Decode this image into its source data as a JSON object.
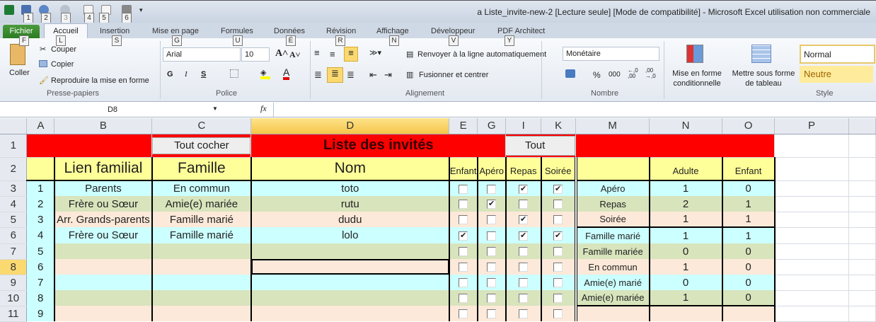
{
  "window": {
    "title": "a Liste_invite-new-2  [Lecture seule]  [Mode de compatibilité]  -  Microsoft Excel utilisation non commerciale"
  },
  "qat_keys": [
    "1",
    "2",
    "3",
    "4",
    "5",
    "6"
  ],
  "tabs": [
    {
      "label": "Fichier",
      "key": "F"
    },
    {
      "label": "Accueil",
      "key": "L"
    },
    {
      "label": "Insertion",
      "key": "S"
    },
    {
      "label": "Mise en page",
      "key": "G"
    },
    {
      "label": "Formules",
      "key": "U"
    },
    {
      "label": "Données",
      "key": "É"
    },
    {
      "label": "Révision",
      "key": "R"
    },
    {
      "label": "Affichage",
      "key": "N"
    },
    {
      "label": "Développeur",
      "key": "V"
    },
    {
      "label": "PDF Architect",
      "key": "Y"
    }
  ],
  "ribbon": {
    "clipboard": {
      "paste": "Coller",
      "cut": "Couper",
      "copy": "Copier",
      "format_painter": "Reproduire la mise en forme",
      "label": "Presse-papiers"
    },
    "font": {
      "name": "Arial",
      "size": "10",
      "bold": "G",
      "italic": "I",
      "underline": "S",
      "label": "Police"
    },
    "alignment": {
      "wrap": "Renvoyer à la ligne automatiquement",
      "merge": "Fusionner et centrer",
      "label": "Alignement"
    },
    "number": {
      "format": "Monétaire",
      "percent": "%",
      "thousands": "000",
      "label": "Nombre"
    },
    "styles": {
      "conditional": "Mise en forme conditionnelle",
      "table": "Mettre sous forme de tableau",
      "normal": "Normal",
      "neutral": "Neutre",
      "label": "Style"
    }
  },
  "formula_bar": {
    "name_box": "D8",
    "fx": "fx",
    "value": ""
  },
  "columns": [
    "A",
    "B",
    "C",
    "D",
    "E",
    "G",
    "I",
    "K",
    "M",
    "N",
    "O",
    "P"
  ],
  "row1": {
    "button_check_all": "Tout  cocher",
    "title": "Liste des invités",
    "button_all": "Tout"
  },
  "headers": {
    "lien": "Lien familial",
    "famille": "Famille",
    "nom": "Nom",
    "enfant": "Enfant",
    "apero": "Apéro",
    "repas": "Repas",
    "soiree": "Soirée",
    "adulte": "Adulte",
    "enfant2": "Enfant"
  },
  "guests": [
    {
      "row": "3",
      "num": "1",
      "lien": "Parents",
      "famille": "En commun",
      "nom": "toto",
      "enfant": false,
      "apero": false,
      "repas": true,
      "soiree": true
    },
    {
      "row": "4",
      "num": "2",
      "lien": "Frère ou Sœur",
      "famille": "Amie(e) mariée",
      "nom": "rutu",
      "enfant": false,
      "apero": true,
      "repas": false,
      "soiree": false
    },
    {
      "row": "5",
      "num": "3",
      "lien": "Arr. Grands-parents",
      "famille": "Famille marié",
      "nom": "dudu",
      "enfant": false,
      "apero": false,
      "repas": true,
      "soiree": false
    },
    {
      "row": "6",
      "num": "4",
      "lien": "Frère ou Sœur",
      "famille": "Famille marié",
      "nom": "lolo",
      "enfant": true,
      "apero": false,
      "repas": true,
      "soiree": true
    },
    {
      "row": "7",
      "num": "5",
      "lien": "",
      "famille": "",
      "nom": "",
      "enfant": false,
      "apero": false,
      "repas": false,
      "soiree": false
    },
    {
      "row": "8",
      "num": "6",
      "lien": "",
      "famille": "",
      "nom": "",
      "enfant": false,
      "apero": false,
      "repas": false,
      "soiree": false
    },
    {
      "row": "9",
      "num": "7",
      "lien": "",
      "famille": "",
      "nom": "",
      "enfant": false,
      "apero": false,
      "repas": false,
      "soiree": false
    },
    {
      "row": "10",
      "num": "8",
      "lien": "",
      "famille": "",
      "nom": "",
      "enfant": false,
      "apero": false,
      "repas": false,
      "soiree": false
    },
    {
      "row": "11",
      "num": "9",
      "lien": "",
      "famille": "",
      "nom": "",
      "enfant": false,
      "apero": false,
      "repas": false,
      "soiree": false
    }
  ],
  "summary": [
    {
      "label": "Apéro",
      "adulte": "1",
      "enfant": "0"
    },
    {
      "label": "Repas",
      "adulte": "2",
      "enfant": "1"
    },
    {
      "label": "Soirée",
      "adulte": "1",
      "enfant": "1"
    },
    {
      "label": "Famille marié",
      "adulte": "1",
      "enfant": "1"
    },
    {
      "label": "Famille mariée",
      "adulte": "0",
      "enfant": "0"
    },
    {
      "label": "En commun",
      "adulte": "1",
      "enfant": "0"
    },
    {
      "label": "Amie(e) marié",
      "adulte": "0",
      "enfant": "0"
    },
    {
      "label": "Amie(e) mariée",
      "adulte": "1",
      "enfant": "0"
    },
    {
      "label": "",
      "adulte": "",
      "enfant": ""
    }
  ],
  "colors": {
    "red": "#ff0000",
    "yellow": "#ffff99",
    "cyan": "#ccffff",
    "green": "#d8e4bc",
    "peach": "#fde9d9"
  }
}
